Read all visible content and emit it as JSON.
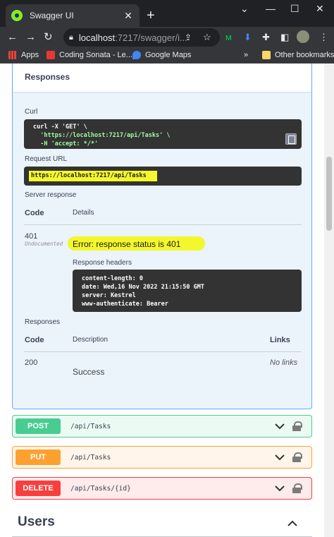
{
  "browser": {
    "tab_title": "Swagger UI",
    "new_tab": "+",
    "window_controls": [
      "⌄",
      "—",
      "☐",
      "✕"
    ],
    "url_host": "localhost",
    "url_rest": ":7217/swagger/i...",
    "bookmarks": [
      {
        "label": "Apps",
        "icon": "apps-grid-icon",
        "color": "#ea4335"
      },
      {
        "label": "Coding Sonata - Le...",
        "icon": "coding-sonata-icon",
        "color": "#e53935"
      },
      {
        "label": "Google Maps",
        "icon": "google-maps-icon",
        "color": "#4285f4"
      }
    ],
    "more_bookmarks": "»",
    "other_bookmarks": "Other bookmarks"
  },
  "get_operation": {
    "responses_title": "Responses",
    "curl_label": "Curl",
    "curl_lines": [
      "curl -X 'GET' \\",
      "  'https://localhost:7217/api/Tasks' \\",
      "  -H 'accept: */*'"
    ],
    "request_url_label": "Request URL",
    "request_url": "https://localhost:7217/api/Tasks",
    "server_response_label": "Server response",
    "code_header": "Code",
    "details_header": "Details",
    "response_code": "401",
    "undocumented": "Undocumented",
    "error_text": "Error: response status is 401",
    "response_headers_label": "Response headers",
    "response_headers": [
      "content-length: 0",
      "date: Wed,16 Nov 2022 21:15:50 GMT",
      "server: Kestrel",
      "www-authenticate: Bearer"
    ],
    "responses_label": "Responses",
    "resp_code_header": "Code",
    "resp_desc_header": "Description",
    "resp_links_header": "Links",
    "resp_code": "200",
    "resp_no_links": "No links",
    "resp_desc": "Success"
  },
  "endpoints": [
    {
      "method": "POST",
      "path": "/api/Tasks",
      "color": "#49cc90",
      "bg": "#ecfaf4",
      "border": "#49cc90"
    },
    {
      "method": "PUT",
      "path": "/api/Tasks",
      "color": "#fca130",
      "bg": "#fff5ea",
      "border": "#fca130"
    },
    {
      "method": "DELETE",
      "path": "/api/Tasks/{id}",
      "color": "#f93e3e",
      "bg": "#feebeb",
      "border": "#f93e3e"
    }
  ],
  "users_section": {
    "title": "Users"
  }
}
